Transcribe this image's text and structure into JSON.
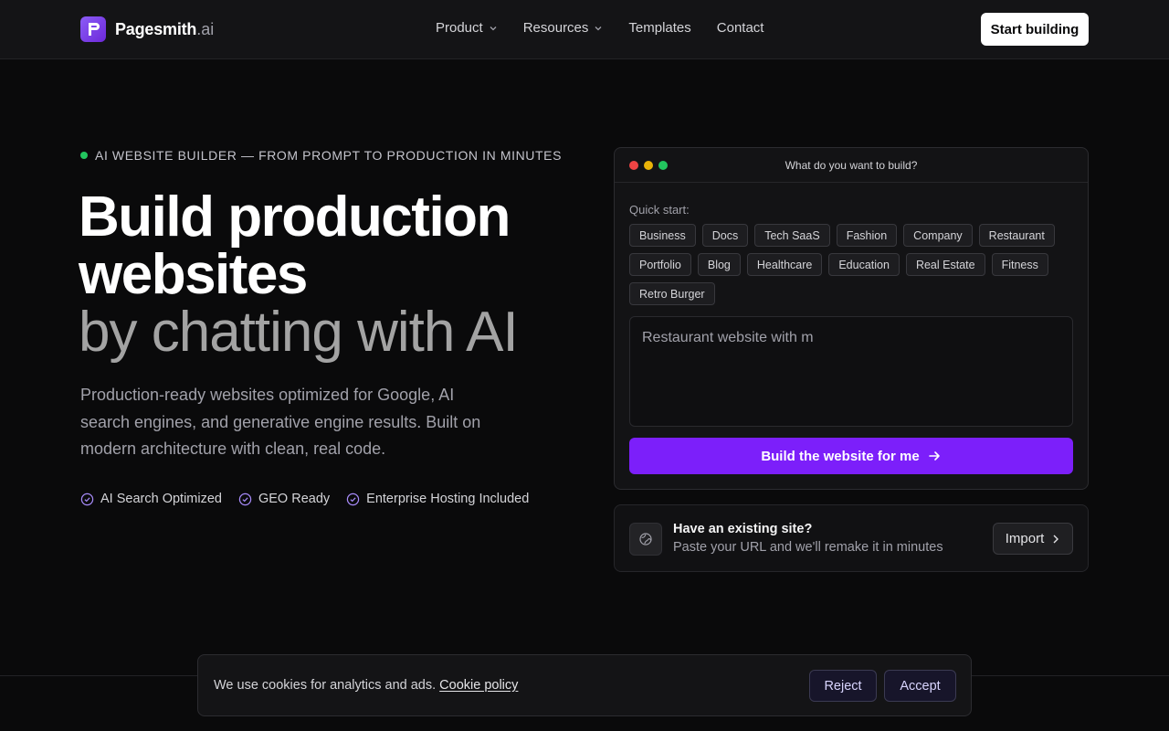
{
  "brand": {
    "name": "Pagesmith",
    "tld": ".ai"
  },
  "nav": {
    "links": [
      {
        "label": "Product",
        "has_dropdown": true
      },
      {
        "label": "Resources",
        "has_dropdown": true
      },
      {
        "label": "Templates",
        "has_dropdown": false
      },
      {
        "label": "Contact",
        "has_dropdown": false
      }
    ],
    "cta": "Start building"
  },
  "hero": {
    "eyebrow": "AI WEBSITE BUILDER — FROM PROMPT TO PRODUCTION IN MINUTES",
    "headline": [
      "Build production",
      "websites"
    ],
    "headline_muted": "by chatting with AI",
    "subcopy": "Production-ready websites optimized for Google, AI search engines, and generative engine results. Built on modern architecture with clean, real code.",
    "features": [
      "AI Search Optimized",
      "GEO Ready",
      "Enterprise Hosting Included"
    ]
  },
  "builder": {
    "title": "What do you want to build?",
    "quick_start_label": "Quick start:",
    "chips": [
      "Business",
      "Docs",
      "Tech SaaS",
      "Fashion",
      "Company",
      "Restaurant",
      "Portfolio",
      "Blog",
      "Healthcare",
      "Education",
      "Real Estate",
      "Fitness",
      "Retro Burger"
    ],
    "prompt_value": "Restaurant website with m",
    "submit_label": "Build the website for me"
  },
  "import": {
    "title": "Have an existing site?",
    "subtitle": "Paste your URL and we'll remake it in minutes",
    "button": "Import"
  },
  "cookie": {
    "text": "We use cookies for analytics and ads.",
    "link": "Cookie policy",
    "reject": "Reject",
    "accept": "Accept"
  },
  "colors": {
    "accent": "#7c1ffa",
    "status_dot": "#22c55e",
    "traffic_red": "#ef4444",
    "traffic_yellow": "#eab308",
    "traffic_green": "#22c55e"
  }
}
